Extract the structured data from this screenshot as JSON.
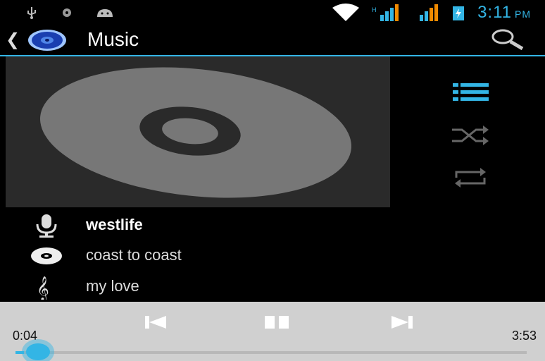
{
  "status_bar": {
    "time": "3:11",
    "ampm": "PM",
    "icons": [
      "usb-icon",
      "notification-icon",
      "android-icon",
      "wifi-icon",
      "signal-icon",
      "signal-icon",
      "battery-icon"
    ]
  },
  "action_bar": {
    "title": "Music",
    "icons": [
      "back-icon",
      "music-app-icon",
      "search-icon"
    ]
  },
  "side_controls": {
    "icons": [
      "playlist-icon",
      "shuffle-icon",
      "repeat-icon"
    ],
    "accent": "#33b5e5"
  },
  "track": {
    "artist": "westlife",
    "album": "coast to coast",
    "title": "my love"
  },
  "playback": {
    "current_time": "0:04",
    "total_time": "3:53",
    "progress": 0.017,
    "state": "playing",
    "icons": [
      "previous-icon",
      "pause-icon",
      "next-icon"
    ]
  },
  "colors": {
    "accent": "#33b5e5",
    "controls_bg": "#d0d0d0"
  }
}
